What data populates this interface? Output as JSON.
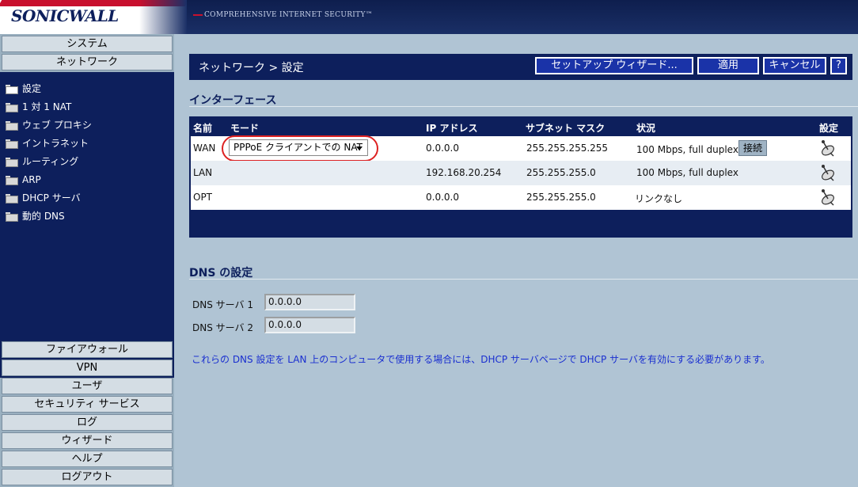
{
  "header": {
    "logo_text": "SONICWALL",
    "tagline": "COMPREHENSIVE INTERNET SECURITY™"
  },
  "sidebar": {
    "top_buttons": [
      "システム",
      "ネットワーク"
    ],
    "tree_items": [
      "設定",
      "1 対 1 NAT",
      "ウェブ プロキシ",
      "イントラネット",
      "ルーティング",
      "ARP",
      "DHCP サーバ",
      "動的 DNS"
    ],
    "bottom_buttons": [
      "ファイアウォール",
      "VPN",
      "ユーザ",
      "セキュリティ サービス",
      "ログ",
      "ウィザード",
      "ヘルプ",
      "ログアウト"
    ]
  },
  "main": {
    "title": "ネットワーク > 設定",
    "buttons": {
      "setup_wizard": "セットアップ ウィザード...",
      "apply": "適用",
      "cancel": "キャンセル",
      "help": "?"
    },
    "interfaces": {
      "heading": "インターフェース",
      "columns": [
        "名前",
        "モード",
        "IP アドレス",
        "サブネット マスク",
        "状況",
        "設定"
      ],
      "rows": [
        {
          "name": "WAN",
          "mode": "PPPoE クライアントでの NAT",
          "ip": "0.0.0.0",
          "mask": "255.255.255.255",
          "status": "100 Mbps, full duplex",
          "action": "接続"
        },
        {
          "name": "LAN",
          "mode": "",
          "ip": "192.168.20.254",
          "mask": "255.255.255.0",
          "status": "100 Mbps, full duplex",
          "action": ""
        },
        {
          "name": "OPT",
          "mode": "",
          "ip": "0.0.0.0",
          "mask": "255.255.255.0",
          "status": "リンクなし",
          "action": ""
        }
      ]
    },
    "dns": {
      "heading": "DNS の設定",
      "server1_label": "DNS サーバ 1",
      "server1_value": "0.0.0.0",
      "server2_label": "DNS サーバ 2",
      "server2_value": "0.0.0.0",
      "note": "これらの DNS 設定を LAN 上のコンピュータで使用する場合には、DHCP サーバページで DHCP サーバを有効にする必要があります。"
    }
  },
  "colors": {
    "navy": "#0d1f5c",
    "page_bg": "#b0c4d4",
    "note_blue": "#1a2fd0",
    "highlight_red": "#d22"
  }
}
